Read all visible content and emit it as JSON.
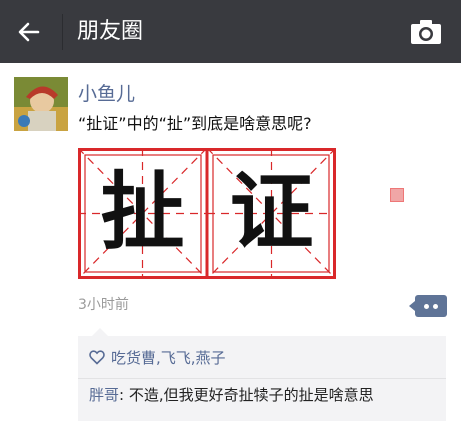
{
  "topbar": {
    "back_icon": "back-arrow-icon",
    "title": "朋友圈",
    "camera_icon": "camera-icon"
  },
  "post": {
    "username": "小鱼儿",
    "text": "“扯证”中的“扯”到底是啥意思呢?",
    "image": {
      "characters": [
        "扯",
        "证"
      ]
    },
    "time": "3小时前",
    "likes": "吃货曹,飞飞,燕子",
    "comment": {
      "author": "胖哥",
      "separator": ": ",
      "text": "不造,但我更好奇扯犊子的扯是啥意思"
    }
  },
  "colors": {
    "topbar_bg": "#393a3f",
    "link_blue": "#576b95",
    "grid_red": "#d9282a"
  }
}
